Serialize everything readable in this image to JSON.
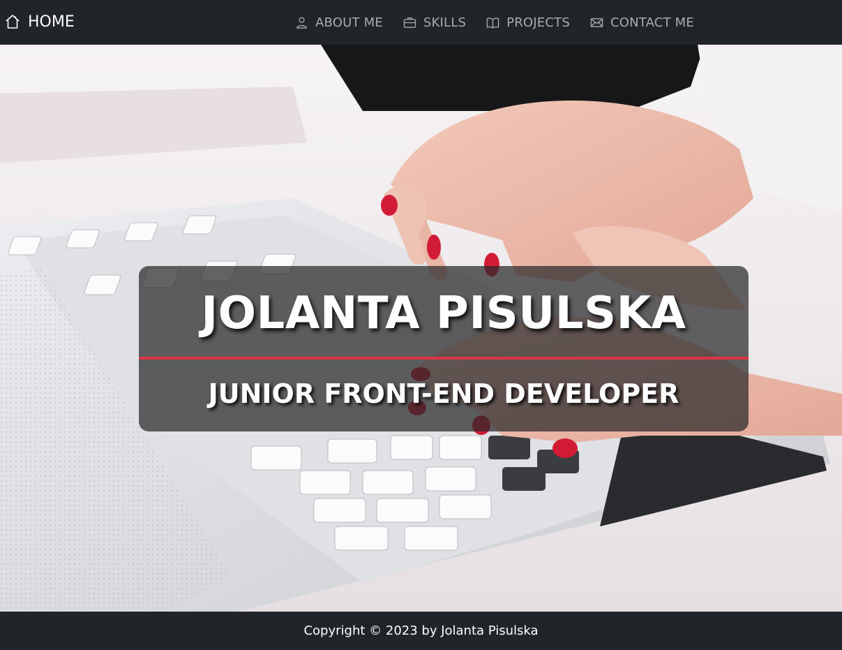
{
  "navbar": {
    "brand": {
      "label": "HOME",
      "icon": "house-icon"
    },
    "links": [
      {
        "label": "ABOUT ME",
        "icon": "person-icon"
      },
      {
        "label": "SKILLS",
        "icon": "briefcase-icon"
      },
      {
        "label": "PROJECTS",
        "icon": "book-icon"
      },
      {
        "label": "CONTACT ME",
        "icon": "envelope-icon"
      }
    ]
  },
  "hero": {
    "name": "JOLANTA PISULSKA",
    "role": "JUNIOR FRONT-END DEVELOPER",
    "background": "laptop-typing-hands-photo"
  },
  "footer": {
    "copyright": "Copyright © 2023 by Jolanta Pisulska"
  },
  "colors": {
    "navbar_bg": "#212529",
    "accent": "#dc3545",
    "nav_text": "#a9acaf"
  }
}
